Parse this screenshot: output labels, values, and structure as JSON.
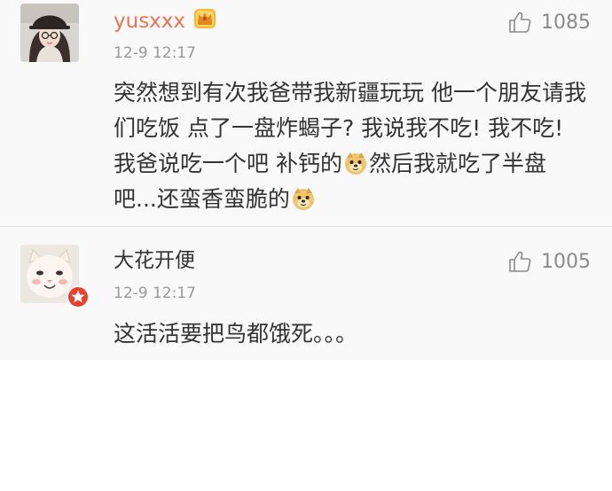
{
  "comments": [
    {
      "username": "yusxxx",
      "timestamp": "12-9 12:17",
      "like_count": "1085",
      "text_parts": [
        "突然想到有次我爸带我新疆玩玩 他一个朋友请我们吃饭 点了一盘炸蝎子? 我说我不吃! 我不吃! 我爸说吃一个吧 补钙的",
        "然后我就吃了半盘吧...还蛮香蛮脆的"
      ],
      "badge_icon": "crown-badge-icon",
      "avatar_icon": "girl-with-hat-avatar"
    },
    {
      "username": "大花开便",
      "timestamp": "12-9 12:17",
      "like_count": "1005",
      "text": "这活活要把鸟都饿死。。。",
      "badge_icon": "red-star-badge-icon",
      "avatar_icon": "cat-face-avatar"
    }
  ],
  "colors": {
    "vip_username": "#eb7350",
    "username": "#333333",
    "timestamp": "#999999",
    "like": "#8a8a8a",
    "comment_bg": "#f9f9f9",
    "page_bg": "#ffffff"
  }
}
